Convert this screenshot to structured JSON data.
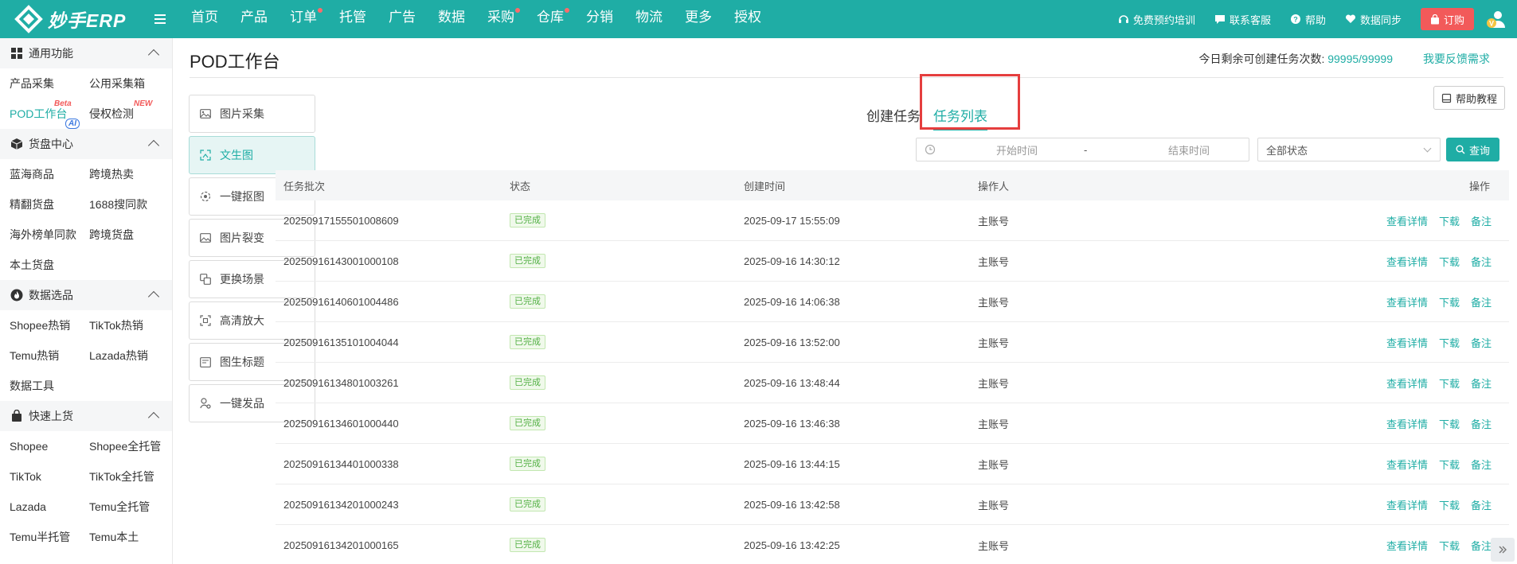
{
  "app": {
    "name": "妙手ERP"
  },
  "nav": [
    "首页",
    "产品",
    "订单",
    "托管",
    "广告",
    "数据",
    "采购",
    "仓库",
    "分销",
    "物流",
    "更多",
    "授权"
  ],
  "nav_dots": [
    false,
    false,
    true,
    false,
    false,
    false,
    true,
    true,
    false,
    false,
    false,
    false
  ],
  "top_right": {
    "training": "免费预约培训",
    "support": "联系客服",
    "help": "帮助",
    "sync": "数据同步",
    "order": "订购"
  },
  "sidebar": {
    "sections": [
      {
        "title": "通用功能",
        "icon": "grid-icon",
        "items": [
          "产品采集",
          "公用采集箱",
          "POD工作台",
          "侵权检测"
        ]
      },
      {
        "title": "货盘中心",
        "icon": "box-icon",
        "items": [
          "蓝海商品",
          "跨境热卖",
          "精翻货盘",
          "1688搜同款",
          "海外榜单同款",
          "跨境货盘",
          "本土货盘"
        ]
      },
      {
        "title": "数据选品",
        "icon": "flame-icon",
        "items": [
          "Shopee热销",
          "TikTok热销",
          "Temu热销",
          "Lazada热销",
          "数据工具"
        ]
      },
      {
        "title": "快速上货",
        "icon": "bag-icon",
        "items": [
          "Shopee",
          "Shopee全托管",
          "TikTok",
          "TikTok全托管",
          "Lazada",
          "Temu全托管",
          "Temu半托管",
          "Temu本土"
        ]
      }
    ],
    "badges": {
      "pod": "Beta",
      "ai": "AI",
      "new": "NEW"
    },
    "active_item": "POD工作台"
  },
  "page": {
    "title": "POD工作台",
    "quota_label": "今日剩余可创建任务次数:",
    "quota_value": "99995/99999",
    "feedback": "我要反馈需求",
    "help_button": "帮助教程"
  },
  "tools": [
    {
      "label": "图片采集",
      "icon": "image-icon"
    },
    {
      "label": "文生图",
      "icon": "text-to-image-icon",
      "active": true
    },
    {
      "label": "一键抠图",
      "icon": "cutout-icon"
    },
    {
      "label": "图片裂变",
      "icon": "image-split-icon"
    },
    {
      "label": "更换场景",
      "icon": "scene-icon"
    },
    {
      "label": "高清放大",
      "icon": "upscale-icon"
    },
    {
      "label": "图生标题",
      "icon": "image-title-icon"
    },
    {
      "label": "一键发品",
      "icon": "publish-icon"
    }
  ],
  "tabs": {
    "create": "创建任务",
    "list": "任务列表"
  },
  "filters": {
    "start": "开始时间",
    "sep": "-",
    "end": "结束时间",
    "status": "全部状态",
    "query": "查询"
  },
  "table": {
    "headers": [
      "任务批次",
      "状态",
      "创建时间",
      "操作人",
      "操作"
    ],
    "actions": {
      "detail": "查看详情",
      "download": "下载",
      "note": "备注"
    },
    "rows": [
      {
        "batch": "20250917155501008609",
        "status": "已完成",
        "time": "2025-09-17 15:55:09",
        "operator": "主账号"
      },
      {
        "batch": "20250916143001000108",
        "status": "已完成",
        "time": "2025-09-16 14:30:12",
        "operator": "主账号"
      },
      {
        "batch": "20250916140601004486",
        "status": "已完成",
        "time": "2025-09-16 14:06:38",
        "operator": "主账号"
      },
      {
        "batch": "20250916135101004044",
        "status": "已完成",
        "time": "2025-09-16 13:52:00",
        "operator": "主账号"
      },
      {
        "batch": "20250916134801003261",
        "status": "已完成",
        "time": "2025-09-16 13:48:44",
        "operator": "主账号"
      },
      {
        "batch": "20250916134601000440",
        "status": "已完成",
        "time": "2025-09-16 13:46:38",
        "operator": "主账号"
      },
      {
        "batch": "20250916134401000338",
        "status": "已完成",
        "time": "2025-09-16 13:44:15",
        "operator": "主账号"
      },
      {
        "batch": "20250916134201000243",
        "status": "已完成",
        "time": "2025-09-16 13:42:58",
        "operator": "主账号"
      },
      {
        "batch": "20250916134201000165",
        "status": "已完成",
        "time": "2025-09-16 13:42:25",
        "operator": "主账号"
      }
    ]
  },
  "colors": {
    "brand": "#1fada5",
    "highlight": "#e53e3e",
    "order_button": "#f25a5a",
    "done_tag": "#52b044"
  }
}
